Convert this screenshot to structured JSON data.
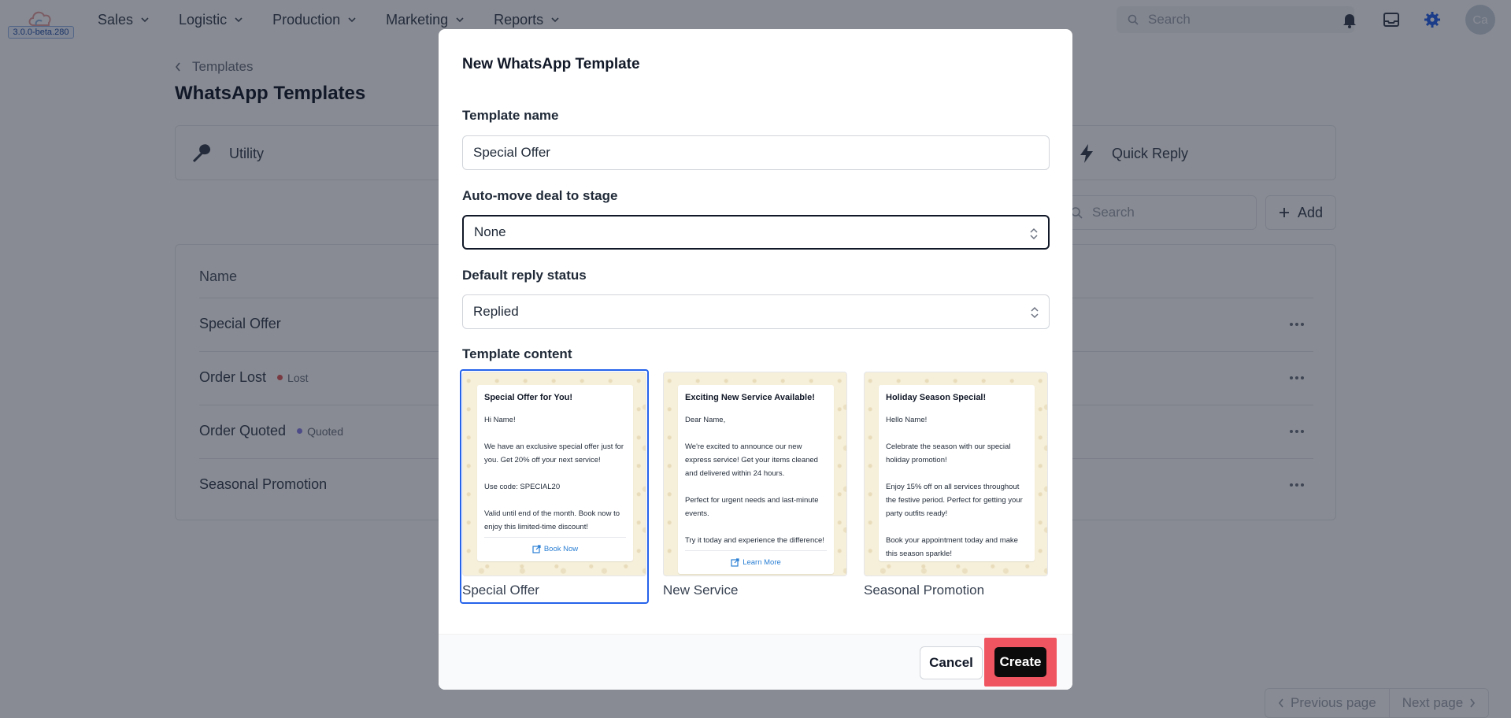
{
  "app": {
    "version": "3.0.0-beta.280",
    "nav": [
      "Sales",
      "Logistic",
      "Production",
      "Marketing",
      "Reports"
    ],
    "search_placeholder": "Search",
    "avatar_initials": "Ca"
  },
  "page": {
    "breadcrumb": "Templates",
    "title": "WhatsApp Templates",
    "categories": [
      "Utility",
      "Quick Reply"
    ],
    "list_search_placeholder": "Search",
    "add_label": "Add",
    "table": {
      "name_header": "Name",
      "rows": [
        {
          "name": "Special Offer",
          "badge": "",
          "badge_color": ""
        },
        {
          "name": "Order Lost",
          "badge": "Lost",
          "badge_color": "#e05a5a"
        },
        {
          "name": "Order Quoted",
          "badge": "Quoted",
          "badge_color": "#8b80e8"
        },
        {
          "name": "Seasonal Promotion",
          "badge": "",
          "badge_color": ""
        }
      ]
    },
    "pagination": {
      "previous": "Previous page",
      "next": "Next page"
    }
  },
  "modal": {
    "title": "New WhatsApp Template",
    "template_name_label": "Template name",
    "template_name_value": "Special Offer",
    "auto_move_label": "Auto-move deal to stage",
    "auto_move_value": "None",
    "reply_status_label": "Default reply status",
    "reply_status_value": "Replied",
    "content_label": "Template content",
    "templates": [
      {
        "caption": "Special Offer",
        "heading": "Special Offer for You!",
        "body": "Hi Name!\n\nWe have an exclusive special offer just for you. Get 20% off your next service!\n\nUse code: SPECIAL20\n\nValid until end of the month. Book now to enjoy this limited-time discount!",
        "button": "Book Now",
        "selected": true
      },
      {
        "caption": "New Service",
        "heading": "Exciting New Service Available!",
        "body": "Dear Name,\n\nWe're excited to announce our new express service! Get your items cleaned and delivered within 24 hours.\n\nPerfect for urgent needs and last-minute events.\n\nTry it today and experience the difference!",
        "button": "Learn More",
        "selected": false
      },
      {
        "caption": "Seasonal Promotion",
        "heading": "Holiday Season Special!",
        "body": "Hello Name!\n\nCelebrate the season with our special holiday promotion!\n\nEnjoy 15% off on all services throughout the festive period. Perfect for getting your party outfits ready!\n\nBook your appointment today and make this season sparkle!",
        "button": "",
        "selected": false
      }
    ],
    "cancel_label": "Cancel",
    "create_label": "Create"
  },
  "colors": {
    "accent": "#2563eb",
    "create_highlight": "#ef5560",
    "primary_button": "#0b0b0b"
  }
}
